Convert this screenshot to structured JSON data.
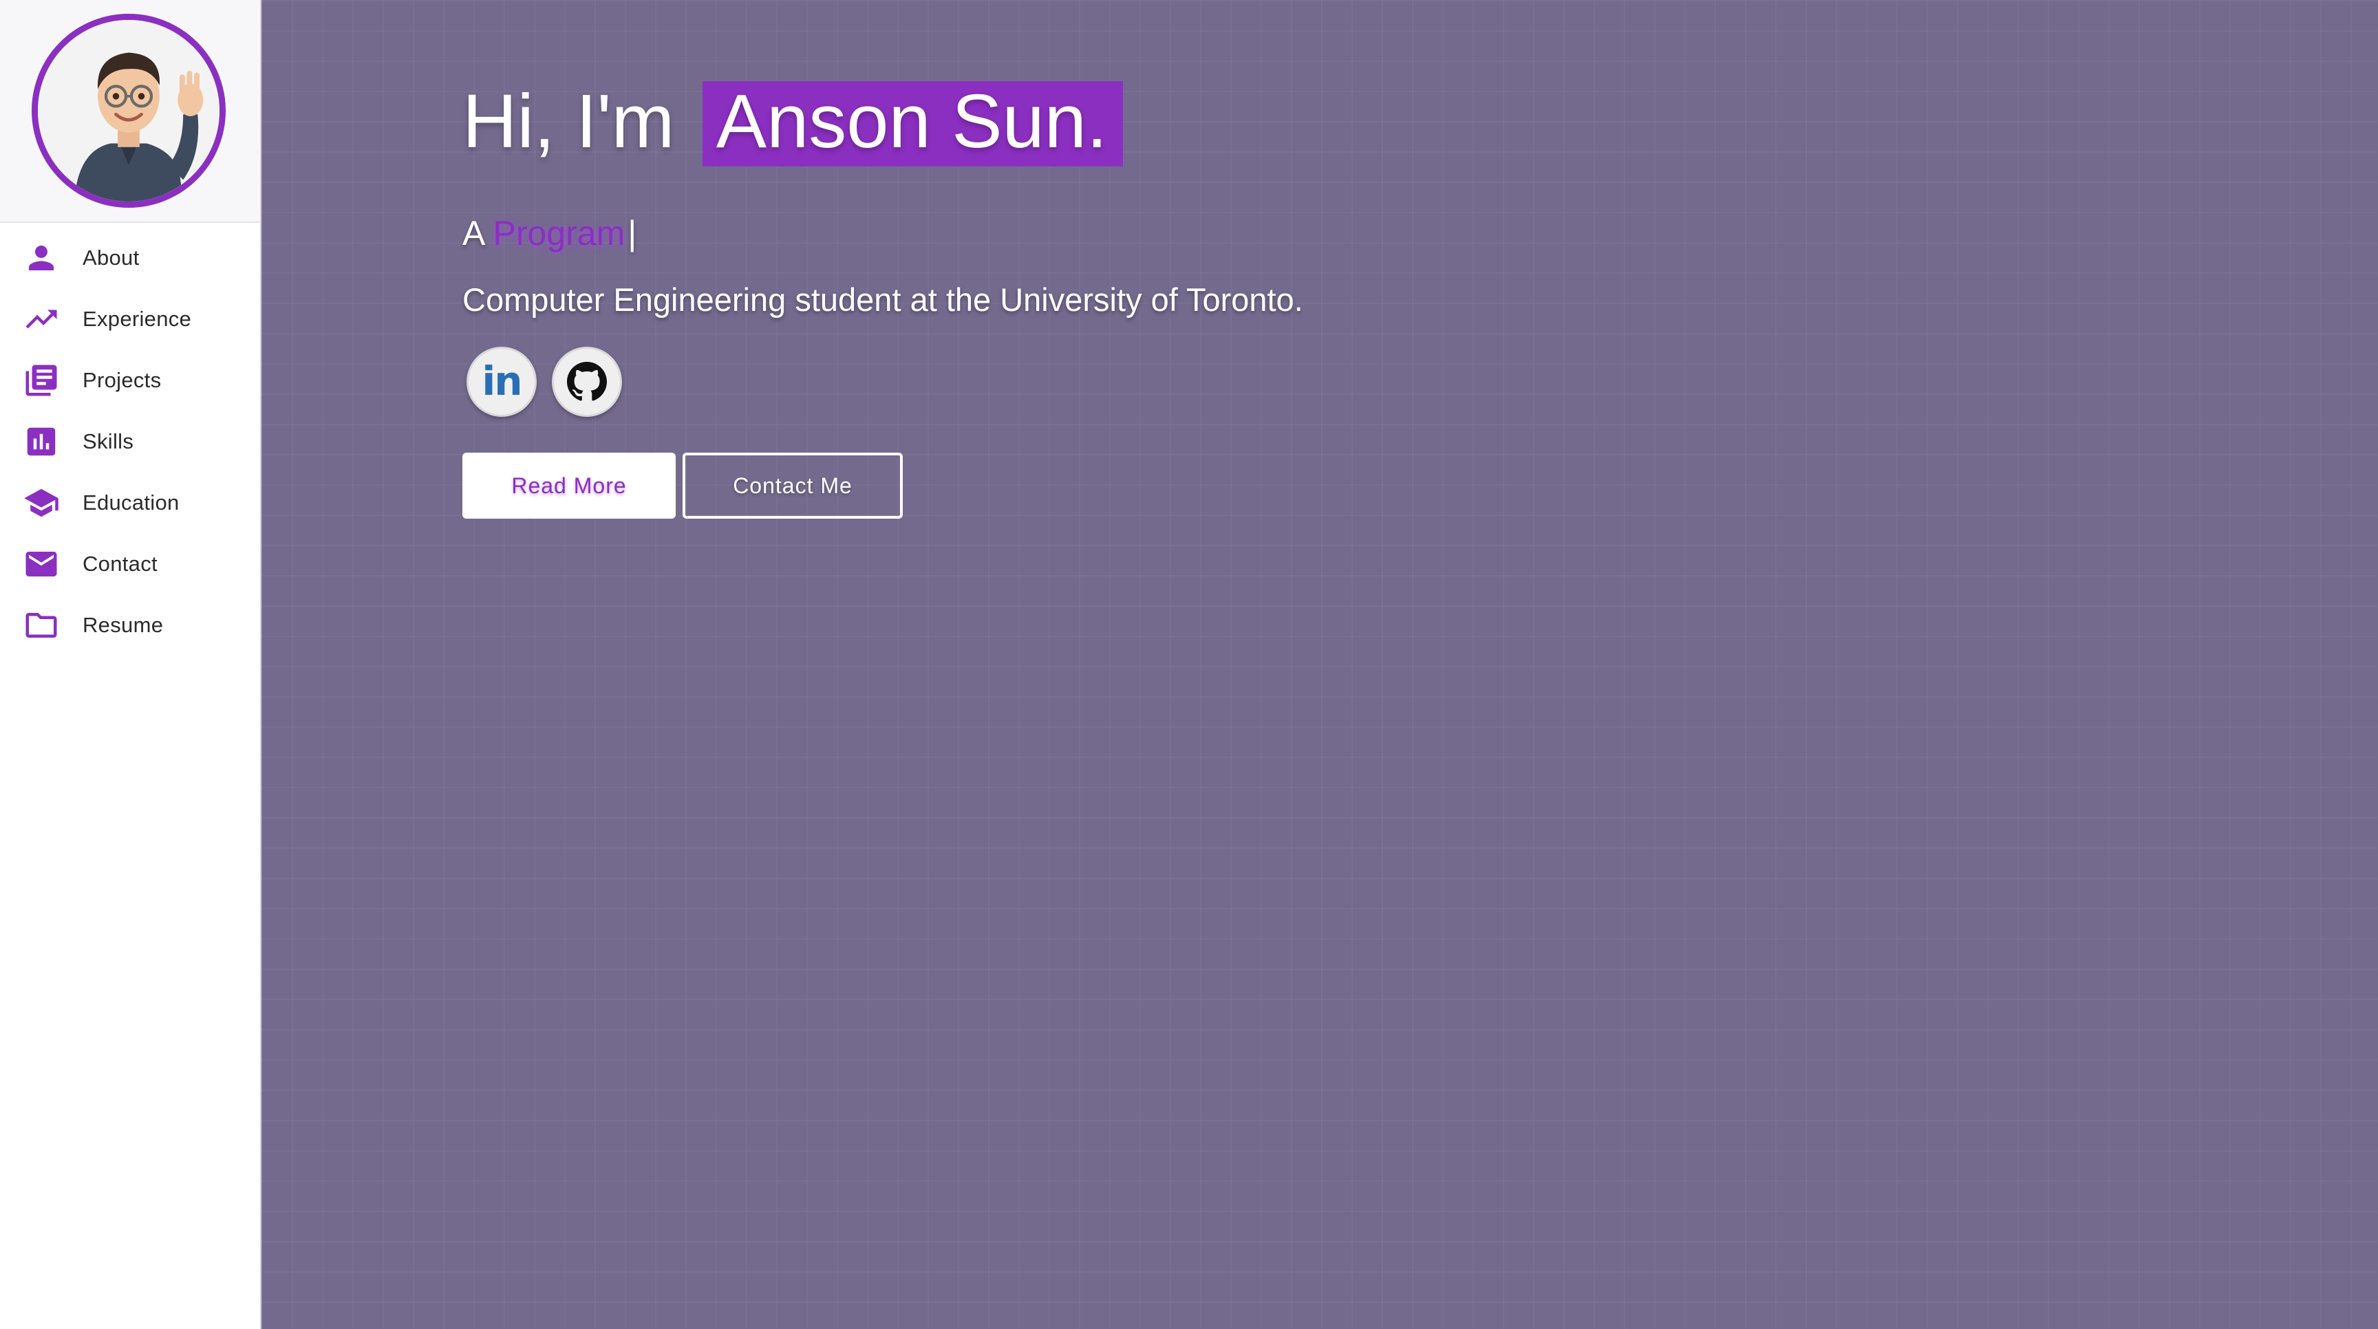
{
  "sidebar": {
    "avatar_alt": "memoji avatar waving",
    "items": [
      {
        "label": "About",
        "icon": "person-icon"
      },
      {
        "label": "Experience",
        "icon": "trending-up-icon"
      },
      {
        "label": "Projects",
        "icon": "library-books-icon"
      },
      {
        "label": "Skills",
        "icon": "bar-chart-icon"
      },
      {
        "label": "Education",
        "icon": "school-icon"
      },
      {
        "label": "Contact",
        "icon": "mail-icon"
      },
      {
        "label": "Resume",
        "icon": "folder-icon"
      }
    ]
  },
  "hero": {
    "greeting": "Hi, I'm",
    "name": "Anson Sun.",
    "typed_prefix": "A",
    "typed_word": "Program",
    "cursor": "|",
    "subtitle": "Computer Engineering student at the University of Toronto."
  },
  "social": {
    "linkedin_icon": "linkedin-icon",
    "linkedin_text": "in",
    "github_icon": "github-icon"
  },
  "buttons": {
    "read_more": "Read More",
    "contact_me": "Contact Me"
  },
  "colors": {
    "accent": "#8b2fc1",
    "background": "#746a8e",
    "sidebar_bg": "#ffffff"
  }
}
